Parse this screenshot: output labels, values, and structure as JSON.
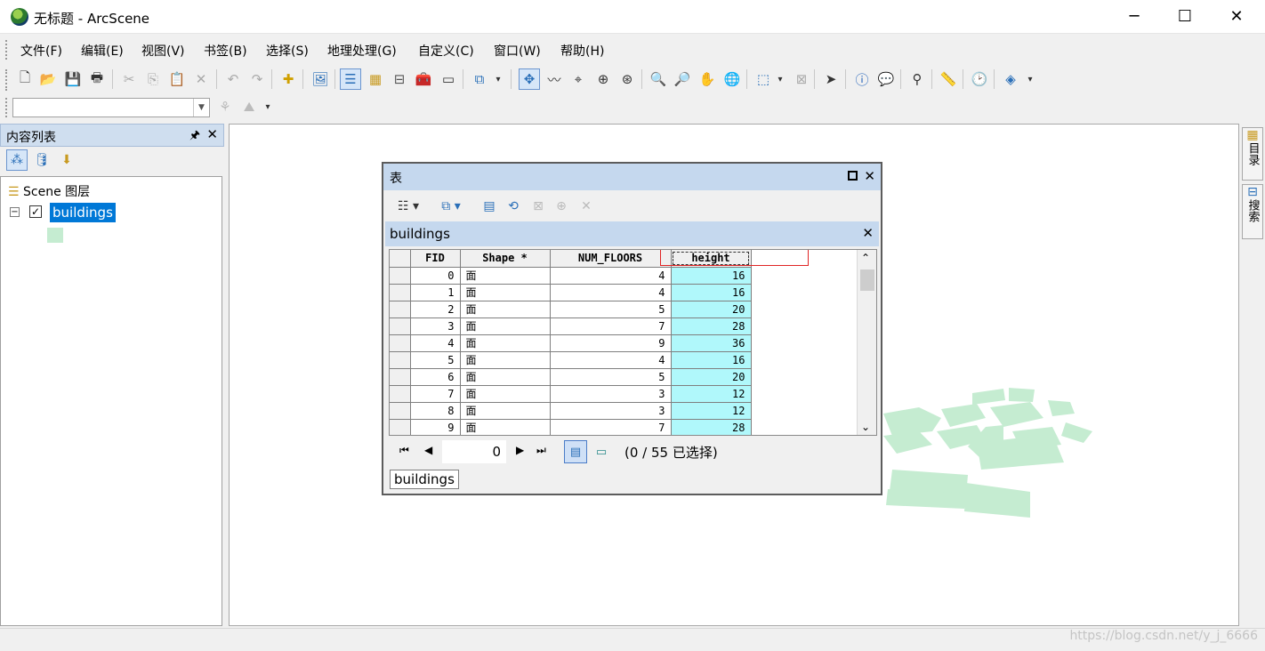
{
  "window": {
    "title": "无标题 - ArcScene",
    "minimize_glyph": "─",
    "maximize_glyph": "☐",
    "close_glyph": "✕"
  },
  "menu": [
    "文件(F)",
    "编辑(E)",
    "视图(V)",
    "书签(B)",
    "选择(S)",
    "地理处理(G)",
    "自定义(C)",
    "窗口(W)",
    "帮助(H)"
  ],
  "toolbar_icons": [
    "new-icon",
    "open-icon",
    "save-icon",
    "print-icon",
    "cut-icon",
    "copy-icon",
    "paste-icon",
    "delete-icon",
    "undo-icon",
    "redo-icon",
    "add-data-icon",
    "scene-properties-icon",
    "table-of-contents-icon",
    "catalog-icon",
    "arctoolbox-icon",
    "python-icon",
    "model-builder-icon",
    "navigate-icon",
    "fly-icon",
    "target-icon",
    "zoom-to-target-icon",
    "center-on-target-icon",
    "zoom-in-icon",
    "zoom-out-icon",
    "pan-icon",
    "full-extent-icon",
    "select-features-icon",
    "clear-selection-icon",
    "select-elements-icon",
    "identify-icon",
    "html-popup-icon",
    "find-icon",
    "measure-icon",
    "time-slider-icon",
    "3d-effects-icon"
  ],
  "toc": {
    "title": "内容列表",
    "pin_glyph": "🖈",
    "close_glyph": "✕",
    "scene_layer_label": "Scene 图层",
    "layer": {
      "name": "buildings",
      "checked": true,
      "symbol_color": "#c5ecd1"
    }
  },
  "right_dock": {
    "catalog_tab": "目录",
    "search_tab": "搜索"
  },
  "table_window": {
    "title": "表",
    "layer_name": "buildings",
    "columns": [
      "FID",
      "Shape *",
      "NUM_FLOORS",
      "height"
    ],
    "rows": [
      [
        "0",
        "面",
        "4",
        "16"
      ],
      [
        "1",
        "面",
        "4",
        "16"
      ],
      [
        "2",
        "面",
        "5",
        "20"
      ],
      [
        "3",
        "面",
        "7",
        "28"
      ],
      [
        "4",
        "面",
        "9",
        "36"
      ],
      [
        "5",
        "面",
        "4",
        "16"
      ],
      [
        "6",
        "面",
        "5",
        "20"
      ],
      [
        "7",
        "面",
        "3",
        "12"
      ],
      [
        "8",
        "面",
        "3",
        "12"
      ],
      [
        "9",
        "面",
        "7",
        "28"
      ]
    ],
    "current_record": "0",
    "selection_text": "(0 / 55 已选择)",
    "tab_label": "buildings"
  },
  "status": {
    "watermark": "https://blog.csdn.net/y_j_6666"
  }
}
